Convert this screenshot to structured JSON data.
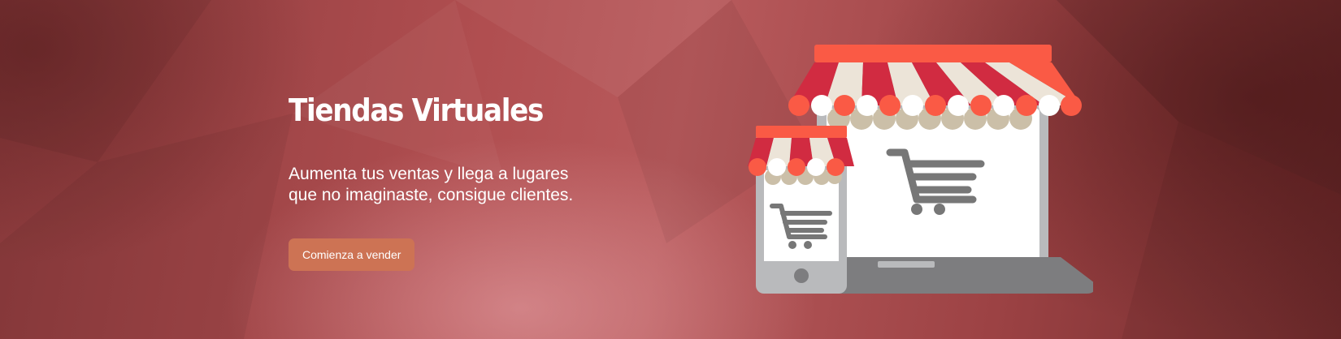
{
  "hero": {
    "title": "Tiendas Virtuales",
    "subtitle_line1": "Aumenta tus ventas y llega a lugares",
    "subtitle_line2": "que no imaginaste, consigue clientes.",
    "cta_label": "Comienza a vender"
  },
  "colors": {
    "background": "#b04e50",
    "button": "#cd7354",
    "awning_red": "#d12b41",
    "awning_cream": "#ece4d8",
    "awning_top": "#fa5a45",
    "device_gray": "#b9babc",
    "cart_gray": "#777777"
  },
  "illustration": {
    "icons": [
      "laptop-storefront-icon",
      "phone-storefront-icon",
      "shopping-cart-icon"
    ]
  }
}
